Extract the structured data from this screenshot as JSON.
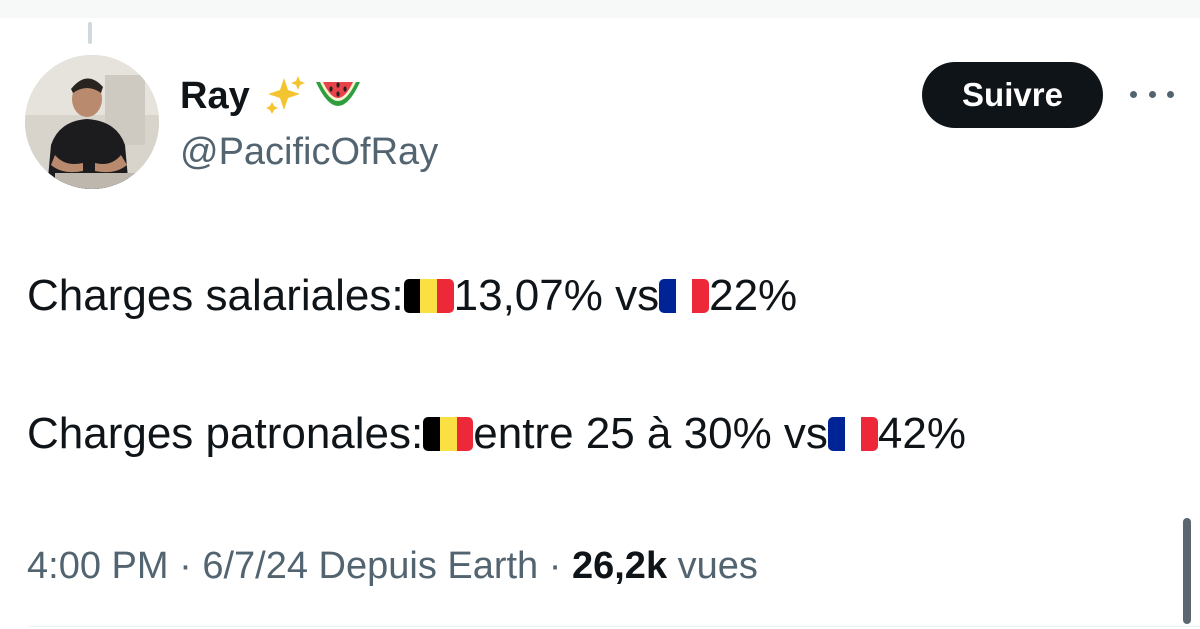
{
  "author": {
    "display_name": "Ray",
    "name_emojis": [
      "sparkles-emoji",
      "watermelon-emoji"
    ],
    "handle": "@PacificOfRay"
  },
  "actions": {
    "follow_label": "Suivre",
    "more_icon": "more-horizontal-icon"
  },
  "tweet": {
    "line1": {
      "label": "Charges salariales: ",
      "belgium_value": "13,07% vs ",
      "france_value": "22%"
    },
    "line2": {
      "label": "Charges patronales: ",
      "belgium_value": " entre 25 à 30% vs ",
      "france_value": " 42%"
    }
  },
  "flags": {
    "belgium": [
      "#000000",
      "#FAE042",
      "#ED2939"
    ],
    "france": [
      "#002395",
      "#FFFFFF",
      "#ED2939"
    ]
  },
  "meta": {
    "time": "4:00 PM",
    "separator": " · ",
    "date": "6/7/24",
    "source": " Depuis Earth",
    "views_count": "26,2k",
    "views_label": " vues"
  },
  "colors": {
    "text_primary": "#0f1419",
    "text_secondary": "#536471",
    "follow_bg": "#0f1419"
  }
}
